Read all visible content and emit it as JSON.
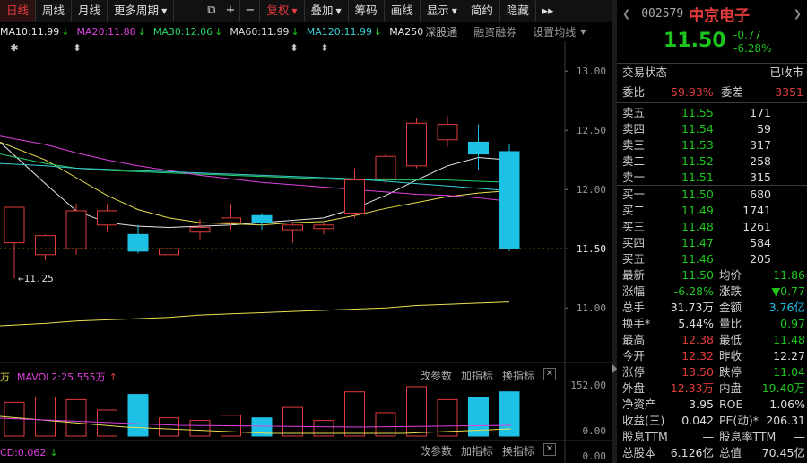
{
  "toolbar": {
    "tabs": [
      "日线",
      "周线",
      "月线",
      "更多周期"
    ],
    "icons": [
      "copy-icon",
      "zoom-in-icon",
      "zoom-out-icon"
    ],
    "fuquan": "复权",
    "tools": [
      "叠加",
      "筹码",
      "画线",
      "显示",
      "简约",
      "隐藏"
    ],
    "expand": "▸▸"
  },
  "ma_bar": {
    "items": [
      {
        "label": "MA10:11.99",
        "arrow": "↓",
        "color": "#e8e8e8"
      },
      {
        "label": "MA20:11.88",
        "arrow": "↓",
        "color": "#e040e0"
      },
      {
        "label": "MA30:12.06",
        "arrow": "↓",
        "color": "#27d36a"
      },
      {
        "label": "MA60:11.99",
        "arrow": "↓",
        "color": "#dddddd"
      },
      {
        "label": "MA120:11.99",
        "arrow": "↓",
        "color": "#3ad0d6"
      },
      {
        "label": "MA250",
        "arrow": "",
        "color": "#e8e8e8"
      }
    ],
    "links": [
      "深股通",
      "融资融券",
      "设置均线"
    ],
    "markers": [
      "✱",
      "⬍",
      "⬍",
      "⬍"
    ]
  },
  "chart_data": {
    "type": "candlestick",
    "y_ticks": [
      "13.00",
      "12.50",
      "12.00",
      "11.50",
      "11.00"
    ],
    "ylim": [
      10.6,
      13.1
    ],
    "current_price_label": "11.50",
    "low_annotation": "11.25",
    "candles": [
      {
        "o": 11.55,
        "h": 11.7,
        "l": 11.25,
        "c": 11.85
      },
      {
        "o": 11.45,
        "h": 11.62,
        "l": 11.4,
        "c": 11.61
      },
      {
        "o": 11.5,
        "h": 11.88,
        "l": 11.45,
        "c": 11.82
      },
      {
        "o": 11.7,
        "h": 11.88,
        "l": 11.64,
        "c": 11.82
      },
      {
        "o": 11.62,
        "h": 11.7,
        "l": 11.46,
        "c": 11.48
      },
      {
        "o": 11.45,
        "h": 11.58,
        "l": 11.35,
        "c": 11.5
      },
      {
        "o": 11.64,
        "h": 11.75,
        "l": 11.58,
        "c": 11.68
      },
      {
        "o": 11.72,
        "h": 11.88,
        "l": 11.66,
        "c": 11.76
      },
      {
        "o": 11.78,
        "h": 11.8,
        "l": 11.66,
        "c": 11.72
      },
      {
        "o": 11.66,
        "h": 11.72,
        "l": 11.55,
        "c": 11.7
      },
      {
        "o": 11.67,
        "h": 11.72,
        "l": 11.62,
        "c": 11.7
      },
      {
        "o": 11.8,
        "h": 12.18,
        "l": 11.76,
        "c": 12.08
      },
      {
        "o": 12.09,
        "h": 12.3,
        "l": 12.05,
        "c": 12.28
      },
      {
        "o": 12.2,
        "h": 12.6,
        "l": 12.18,
        "c": 12.56
      },
      {
        "o": 12.42,
        "h": 12.62,
        "l": 12.36,
        "c": 12.55
      },
      {
        "o": 12.4,
        "h": 12.55,
        "l": 12.16,
        "c": 12.3
      },
      {
        "o": 12.32,
        "h": 12.38,
        "l": 11.48,
        "c": 11.5
      }
    ],
    "ma_series": [
      {
        "name": "MA10",
        "color": "#e8e8e8",
        "values": [
          12.4,
          12.05,
          11.82,
          11.72,
          11.69,
          11.68,
          11.69,
          11.7,
          11.72,
          11.74,
          11.76,
          11.84,
          11.95,
          12.08,
          12.2,
          12.27,
          12.25
        ]
      },
      {
        "name": "MA20",
        "color": "#e8e050",
        "values": [
          12.4,
          12.25,
          12.1,
          11.95,
          11.83,
          11.76,
          11.72,
          11.71,
          11.7,
          11.72,
          11.73,
          11.78,
          11.84,
          11.89,
          11.94,
          11.97,
          11.99
        ]
      },
      {
        "name": "MA30",
        "color": "#27d36a",
        "values": [
          12.3,
          12.22,
          12.18,
          12.16,
          12.15,
          12.14,
          12.13,
          12.12,
          12.11,
          12.1,
          12.09,
          12.08,
          12.08,
          12.08,
          12.08,
          12.07,
          12.06
        ]
      },
      {
        "name": "MA60",
        "color": "#e040e0",
        "values": [
          12.45,
          12.38,
          12.31,
          12.25,
          12.2,
          12.16,
          12.12,
          12.09,
          12.06,
          12.04,
          12.02,
          12.0,
          11.98,
          11.96,
          11.95,
          11.93,
          11.9
        ]
      },
      {
        "name": "MA120",
        "color": "#3ad0d6",
        "values": [
          12.22,
          12.2,
          12.18,
          12.17,
          12.16,
          12.15,
          12.14,
          12.13,
          12.12,
          12.11,
          12.1,
          12.09,
          12.07,
          12.05,
          12.03,
          12.01,
          11.99
        ]
      },
      {
        "name": "MA250",
        "color": "#e8e050",
        "values": [
          10.85,
          10.87,
          10.89,
          10.9,
          10.91,
          10.92,
          10.94,
          10.95,
          10.96,
          10.97,
          10.98,
          10.99,
          11.0,
          11.02,
          11.03,
          11.04,
          11.05
        ]
      }
    ],
    "volume": [
      130,
      150,
      140,
      100,
      160,
      70,
      60,
      80,
      70,
      110,
      60,
      170,
      90,
      190,
      140,
      150,
      170
    ],
    "volume_ticks": [
      "152.00",
      "0.00"
    ],
    "macd_ticks": [
      "0.00"
    ]
  },
  "vol_panel": {
    "left": "万",
    "mavol": "MAVOL2:25.555万",
    "arrow": "↑",
    "btns": [
      "改参数",
      "加指标",
      "换指标"
    ],
    "close": "✕"
  },
  "macd_panel": {
    "left": "CD:0.062",
    "arrow": "↓",
    "btns": [
      "改参数",
      "加指标",
      "换指标"
    ],
    "close": "✕"
  },
  "quote": {
    "code": "002579",
    "name": "中京电子",
    "price": "11.50",
    "change": "-0.77",
    "change_pct": "-6.28%",
    "status_label": "交易状态",
    "status": "已收市",
    "weibi_label": "委比",
    "weibi": "59.93%",
    "weicha_label": "委差",
    "weicha": "3351",
    "asks": [
      {
        "label": "卖五",
        "price": "11.55",
        "vol": "171"
      },
      {
        "label": "卖四",
        "price": "11.54",
        "vol": "59"
      },
      {
        "label": "卖三",
        "price": "11.53",
        "vol": "317"
      },
      {
        "label": "卖二",
        "price": "11.52",
        "vol": "258"
      },
      {
        "label": "卖一",
        "price": "11.51",
        "vol": "315"
      }
    ],
    "bids": [
      {
        "label": "买一",
        "price": "11.50",
        "vol": "680"
      },
      {
        "label": "买二",
        "price": "11.49",
        "vol": "1741"
      },
      {
        "label": "买三",
        "price": "11.48",
        "vol": "1261"
      },
      {
        "label": "买四",
        "price": "11.47",
        "vol": "584"
      },
      {
        "label": "买五",
        "price": "11.46",
        "vol": "205"
      }
    ],
    "stats": [
      [
        {
          "l": "最新",
          "v": "11.50",
          "c": "g"
        },
        {
          "l": "均价",
          "v": "11.86",
          "c": "g"
        }
      ],
      [
        {
          "l": "涨幅",
          "v": "-6.28%",
          "c": "g"
        },
        {
          "l": "涨跌",
          "v": "▼0.77",
          "c": "g"
        }
      ],
      [
        {
          "l": "总手",
          "v": "31.73万",
          "c": "w"
        },
        {
          "l": "金额",
          "v": "3.76亿",
          "c": "c"
        }
      ],
      [
        {
          "l": "换手*",
          "v": "5.44%",
          "c": "w"
        },
        {
          "l": "量比",
          "v": "0.97",
          "c": "g"
        }
      ],
      [
        {
          "l": "最高",
          "v": "12.38",
          "c": "r"
        },
        {
          "l": "最低",
          "v": "11.48",
          "c": "g"
        }
      ],
      [
        {
          "l": "今开",
          "v": "12.32",
          "c": "r"
        },
        {
          "l": "昨收",
          "v": "12.27",
          "c": "w"
        }
      ],
      [
        {
          "l": "涨停",
          "v": "13.50",
          "c": "r"
        },
        {
          "l": "跌停",
          "v": "11.04",
          "c": "g"
        }
      ],
      [
        {
          "l": "外盘",
          "v": "12.33万",
          "c": "r"
        },
        {
          "l": "内盘",
          "v": "19.40万",
          "c": "g"
        }
      ],
      [
        {
          "l": "净资产",
          "v": "3.95",
          "c": "w"
        },
        {
          "l": "ROE",
          "v": "1.06%",
          "c": "w"
        }
      ],
      [
        {
          "l": "收益(三)",
          "v": "0.042",
          "c": "w"
        },
        {
          "l": "PE(动)*",
          "v": "206.31",
          "c": "w"
        }
      ],
      [
        {
          "l": "股息TTM",
          "v": "—",
          "c": "w"
        },
        {
          "l": "股息率TTM",
          "v": "—",
          "c": "w"
        }
      ],
      [
        {
          "l": "总股本",
          "v": "6.126亿",
          "c": "w"
        },
        {
          "l": "总值",
          "v": "70.45亿",
          "c": "w"
        }
      ]
    ]
  }
}
